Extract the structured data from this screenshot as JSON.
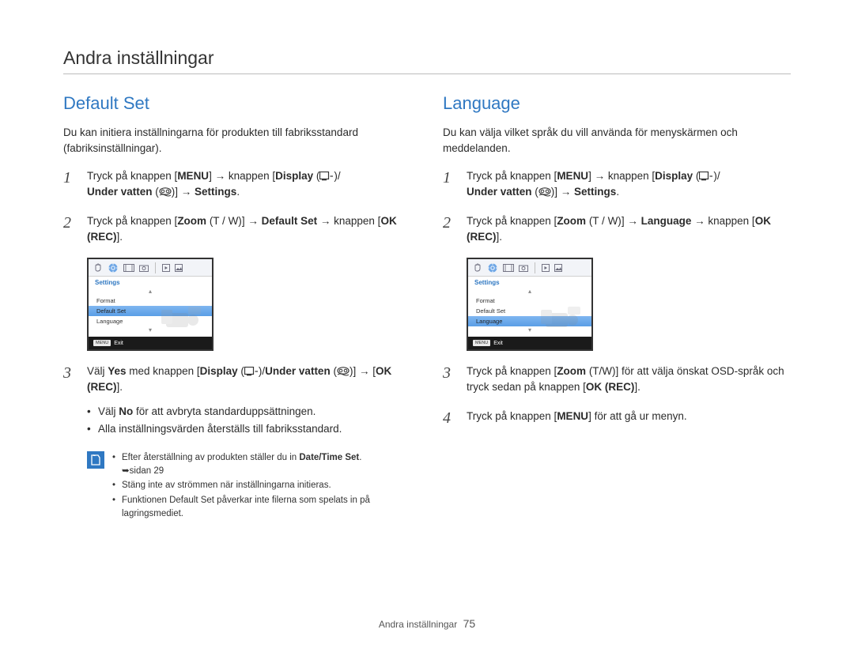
{
  "page": {
    "title": "Andra inställningar",
    "footer_label": "Andra inställningar",
    "page_number": "75"
  },
  "icons": {
    "display": "display-icon",
    "underwater": "underwater-icon",
    "arrow": "→"
  },
  "left": {
    "heading": "Default Set",
    "intro": "Du kan initiera inställningarna för produkten till fabriksstandard (fabriksinställningar).",
    "step1_prefix": "Tryck på knappen [",
    "step1_menu": "MENU",
    "step1_mid1": "] ",
    "step1_mid2": " knappen [",
    "step1_display": "Display",
    "step1_under": "Under vatten",
    "step1_settings": "Settings",
    "step1_close": ".",
    "step2_prefix": "Tryck på knappen [",
    "step2_zoom": "Zoom",
    "step2_tw": " (T / W)",
    "step2_mid": "] ",
    "step2_default": "Default Set",
    "step2_mid2": " knappen [",
    "step2_ok": "OK (REC)",
    "step2_close": "].",
    "step3_a": "Välj ",
    "step3_yes": "Yes",
    "step3_b": " med knappen [",
    "step3_display": "Display",
    "step3_slash": "/",
    "step3_under": "Under vatten",
    "step3_c": "] ",
    "step3_d": " [",
    "step3_ok": "OK (REC)",
    "step3_close": "].",
    "sub1_a": "Välj ",
    "sub1_no": "No",
    "sub1_b": " för att avbryta standarduppsättningen.",
    "sub2": "Alla inställningsvärden återställs till fabriksstandard.",
    "note1_a": "Efter återställning av produkten ställer du in ",
    "note1_b": "Date/Time Set",
    "note1_c": ". ",
    "note1_ref": "➥sidan 29",
    "note2": "Stäng inte av strömmen när inställningarna initieras.",
    "note3": "Funktionen Default Set påverkar inte filerna som spelats in på lagringsmediet.",
    "screenshot": {
      "title": "Settings",
      "rows": [
        "Format",
        "Default Set",
        "Language"
      ],
      "selected_index": 1,
      "exit": "Exit",
      "menu": "MENU"
    }
  },
  "right": {
    "heading": "Language",
    "intro": "Du kan välja vilket språk du vill använda för menyskärmen och meddelanden.",
    "step1_prefix": "Tryck på knappen [",
    "step1_menu": "MENU",
    "step1_mid1": "] ",
    "step1_mid2": " knappen [",
    "step1_display": "Display",
    "step1_under": "Under vatten",
    "step1_settings": "Settings",
    "step1_close": ".",
    "step2_prefix": "Tryck på knappen [",
    "step2_zoom": "Zoom",
    "step2_tw": " (T / W)",
    "step2_mid": "] ",
    "step2_lang": "Language",
    "step2_mid2": " knappen [",
    "step2_ok": "OK (REC)",
    "step2_close": "].",
    "step3_a": "Tryck på knappen [",
    "step3_zoom": "Zoom",
    "step3_tw": " (T/W)",
    "step3_b": "] för att välja önskat OSD-språk och tryck sedan på knappen [",
    "step3_ok": "OK (REC)",
    "step3_close": "].",
    "step4_a": "Tryck på knappen [",
    "step4_menu": "MENU",
    "step4_b": "] för att gå ur menyn.",
    "screenshot": {
      "title": "Settings",
      "rows": [
        "Format",
        "Default Set",
        "Language"
      ],
      "selected_index": 2,
      "exit": "Exit",
      "menu": "MENU"
    }
  }
}
